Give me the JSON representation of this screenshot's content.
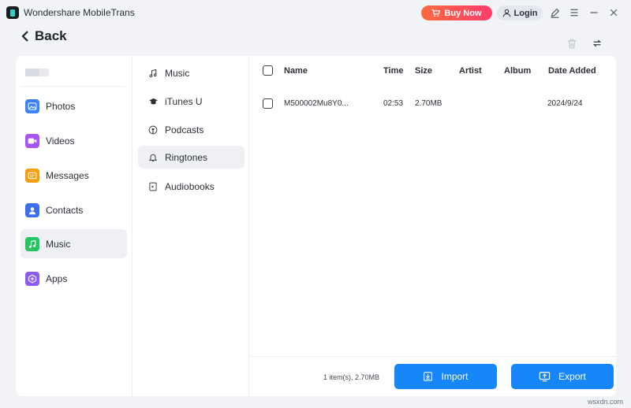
{
  "window": {
    "title": "Wondershare MobileTrans",
    "buy_label": "Buy Now",
    "login_label": "Login"
  },
  "nav": {
    "back_label": "Back"
  },
  "categories": [
    {
      "label": "Photos",
      "icon": "photos-icon",
      "color": "#3b82f6"
    },
    {
      "label": "Videos",
      "icon": "videos-icon",
      "color": "#a855f7"
    },
    {
      "label": "Messages",
      "icon": "messages-icon",
      "color": "#f59e0b"
    },
    {
      "label": "Contacts",
      "icon": "contacts-icon",
      "color": "#3b6ff0"
    },
    {
      "label": "Music",
      "icon": "music-icon",
      "color": "#22c55e",
      "selected": true
    },
    {
      "label": "Apps",
      "icon": "apps-icon",
      "color": "#8b5cf6"
    }
  ],
  "subcategories": [
    {
      "label": "Music",
      "icon": "music-note-icon"
    },
    {
      "label": "iTunes U",
      "icon": "graduation-cap-icon"
    },
    {
      "label": "Podcasts",
      "icon": "podcast-icon"
    },
    {
      "label": "Ringtones",
      "icon": "bell-icon",
      "selected": true
    },
    {
      "label": "Audiobooks",
      "icon": "audiobook-icon"
    }
  ],
  "table": {
    "columns": [
      "Name",
      "Time",
      "Size",
      "Artist",
      "Album",
      "Date Added"
    ],
    "rows": [
      {
        "name": "M500002Mu8Y0...",
        "time": "02:53",
        "size": "2.70MB",
        "artist": "",
        "album": "",
        "date_added": "2024/9/24"
      }
    ]
  },
  "footer": {
    "summary": "1 item(s), 2.70MB",
    "import_label": "Import",
    "export_label": "Export"
  },
  "watermark": "wsxdn.com",
  "colors": {
    "accent": "#1786f8",
    "buy_gradient_start": "#ff6a3d",
    "buy_gradient_end": "#ff3d6e"
  }
}
